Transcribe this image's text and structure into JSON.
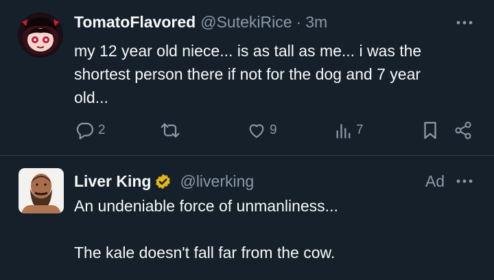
{
  "tweet1": {
    "display_name": "TomatoFlavored",
    "handle": "@SutekiRice",
    "separator": "·",
    "time": "3m",
    "text_lines": [
      "my 12 year old niece... is as tall as me... i was the",
      "shortest person there if not for the dog and 7 year",
      "old..."
    ],
    "replies": "2",
    "likes": "9",
    "views": "7"
  },
  "tweet2": {
    "display_name": "Liver King",
    "handle": "@liverking",
    "ad_label": "Ad",
    "text_line_1": "An undeniable force of unmanliness...",
    "text_line_2": "The kale doesn't fall far from the cow."
  },
  "colors": {
    "background": "#15202b",
    "text": "#f7f9f9",
    "secondary": "#8b98a5",
    "divider": "#38444d",
    "verified_gold": "#e2b719"
  },
  "icons": {
    "reply": "reply-icon",
    "retweet": "retweet-icon",
    "like": "heart-icon",
    "views": "views-icon",
    "bookmark": "bookmark-icon",
    "share": "share-icon",
    "more": "more-dots-icon",
    "verified": "verified-badge-icon"
  }
}
